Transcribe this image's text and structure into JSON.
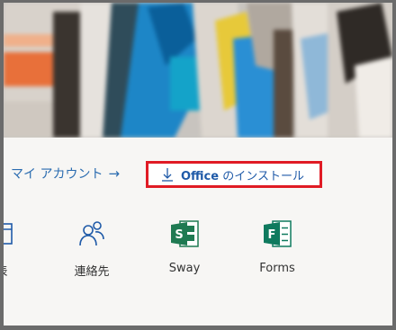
{
  "account_link": {
    "label": "マイ アカウント",
    "arrow": "→"
  },
  "install": {
    "label_brand": "Office",
    "label_rest": " のインストール"
  },
  "apps": [
    {
      "label": "表"
    },
    {
      "label": "連絡先"
    },
    {
      "label": "Sway"
    },
    {
      "label": "Forms"
    }
  ],
  "colors": {
    "link": "#2b6cb0",
    "highlight_box": "#e01b24",
    "sway_green": "#1f7a52",
    "forms_green": "#0f7a5e"
  }
}
